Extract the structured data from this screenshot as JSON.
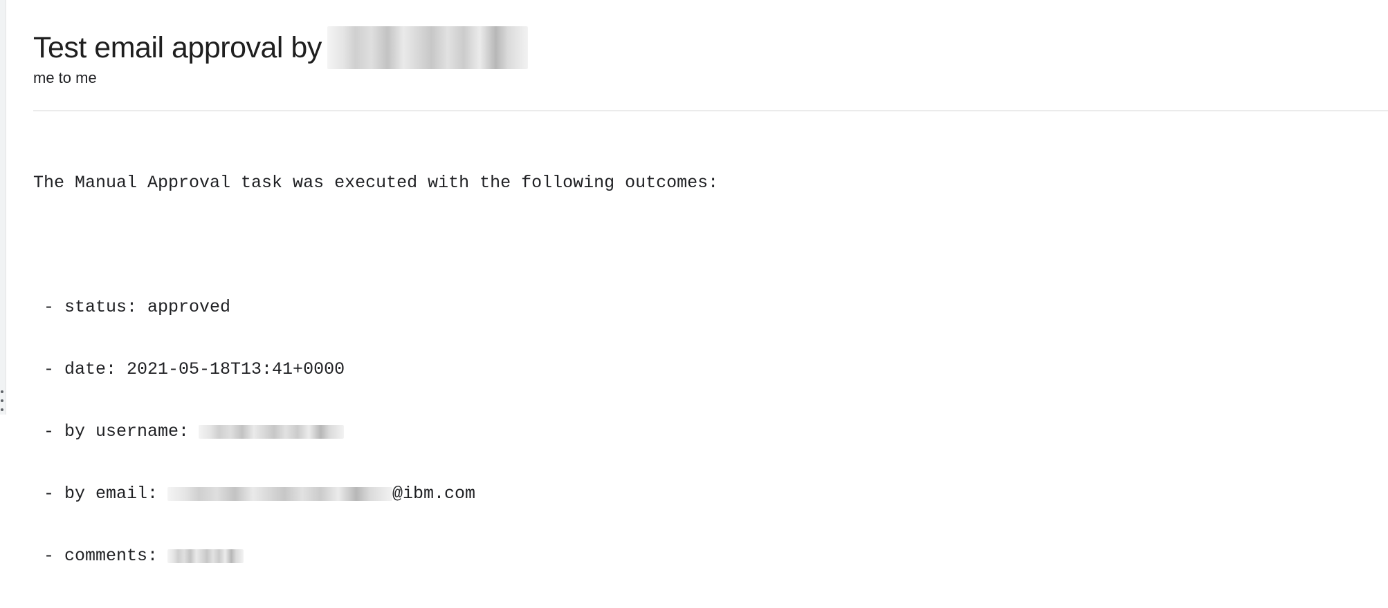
{
  "email": {
    "subject": "Test email approval by",
    "recipients": "me to me",
    "body": {
      "intro": "The Manual Approval task was executed with the following outcomes:",
      "status_line": " - status: approved",
      "date_line": " - date: 2021-05-18T13:41+0000",
      "username_label": " - by username:",
      "email_label": " - by email:",
      "email_domain": "@ibm.com",
      "comments_label": " - comments:"
    }
  }
}
